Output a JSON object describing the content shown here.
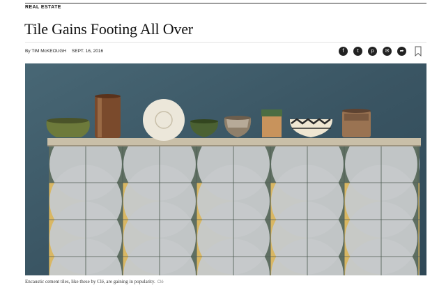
{
  "header": {
    "section": "REAL ESTATE",
    "headline": "Tile Gains Footing All Over"
  },
  "byline": {
    "author": "By TIM McKEOUGH",
    "date": "SEPT. 16, 2016"
  },
  "share_icons": [
    "facebook-icon",
    "twitter-icon",
    "pinterest-icon",
    "email-icon",
    "share-icon"
  ],
  "share_glyphs": {
    "facebook": "f",
    "twitter": "t",
    "pinterest": "p",
    "email": "✉",
    "share": "➦"
  },
  "photo": {
    "colors": {
      "wall": "#3d5a68",
      "tile_green": "#5f6f62",
      "tile_grey": "#c6c9cb",
      "tile_gold": "#d9b763",
      "shelf": "#c9bfa8"
    }
  },
  "caption": {
    "text": "Encaustic cement tiles, like these by Clé, are gaining in popularity.",
    "credit": "Clé"
  }
}
